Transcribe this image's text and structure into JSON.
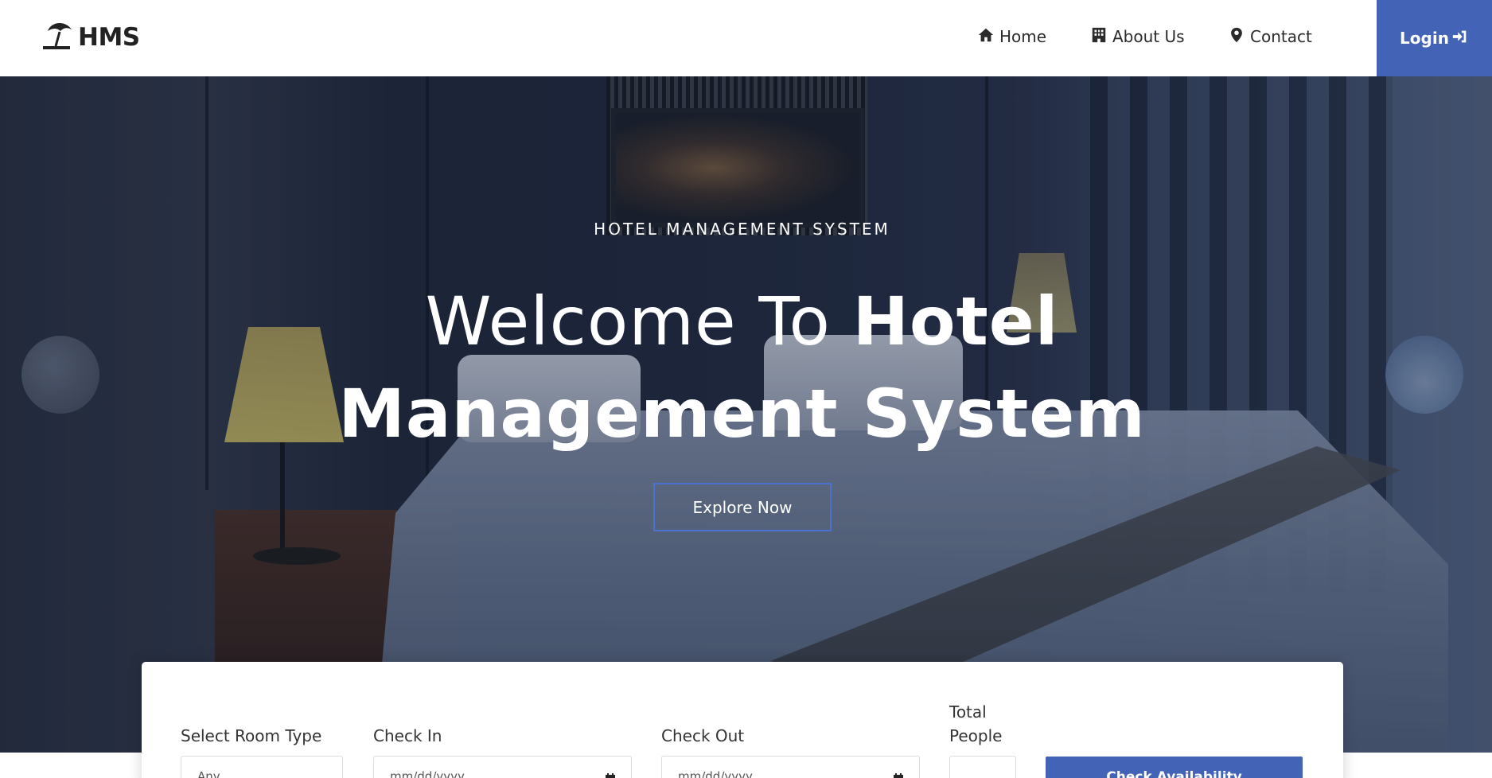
{
  "header": {
    "brand": "HMS",
    "nav": [
      {
        "label": "Home",
        "icon": "home-icon"
      },
      {
        "label": "About Us",
        "icon": "building-icon"
      },
      {
        "label": "Contact",
        "icon": "map-marker-icon"
      }
    ],
    "login_label": "Login",
    "login_icon": "sign-in-icon"
  },
  "hero": {
    "subtitle": "HOTEL MANAGEMENT SYSTEM",
    "title_light": "Welcome To ",
    "title_bold_1": "Hotel",
    "title_bold_2": "Management System",
    "cta_label": "Explore Now"
  },
  "booking": {
    "room_type_label": "Select Room Type",
    "room_type_value": "Any",
    "check_in_label": "Check In",
    "check_in_placeholder": "mm/dd/yyyy",
    "check_out_label": "Check Out",
    "check_out_placeholder": "mm/dd/yyyy",
    "people_label": "Total People",
    "submit_label": "Check Availability"
  },
  "colors": {
    "accent": "#4263b6",
    "cta_border": "#4a73d1",
    "text_dark": "#2b2b2b"
  }
}
